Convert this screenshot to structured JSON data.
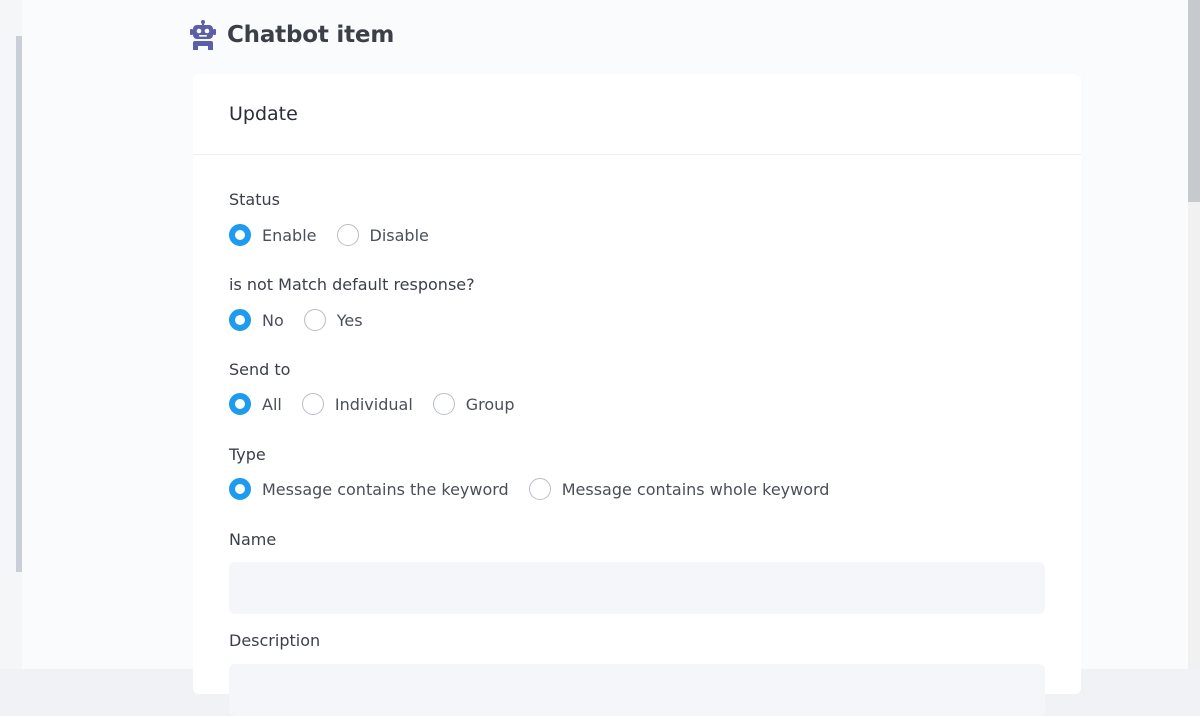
{
  "page": {
    "title": "Chatbot item"
  },
  "card": {
    "title": "Update"
  },
  "form": {
    "status": {
      "label": "Status",
      "options": [
        "Enable",
        "Disable"
      ],
      "selected": "Enable"
    },
    "not_match": {
      "label": "is not Match default response?",
      "options": [
        "No",
        "Yes"
      ],
      "selected": "No"
    },
    "send_to": {
      "label": "Send to",
      "options": [
        "All",
        "Individual",
        "Group"
      ],
      "selected": "All"
    },
    "type": {
      "label": "Type",
      "options": [
        "Message contains the keyword",
        "Message contains whole keyword"
      ],
      "selected": "Message contains the keyword"
    },
    "name": {
      "label": "Name",
      "value": "",
      "placeholder": ""
    },
    "description": {
      "label": "Description",
      "value": "",
      "placeholder": ""
    }
  },
  "colors": {
    "accent": "#1c9bf0",
    "robot_icon": "#5b5fa8"
  },
  "icons": {
    "header": "robot-icon"
  }
}
